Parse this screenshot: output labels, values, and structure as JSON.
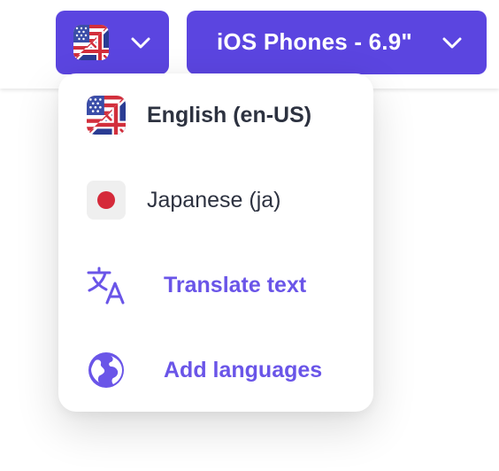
{
  "language_button": {
    "flag_icon": "us-uk-flag-icon",
    "chevron_icon": "chevron-down-icon"
  },
  "device_selector": {
    "label": "iOS Phones - 6.9\"",
    "chevron_icon": "chevron-down-icon"
  },
  "language_menu": {
    "items": [
      {
        "label": "English (en-US)",
        "icon": "us-uk-flag-icon",
        "selected": true
      },
      {
        "label": "Japanese (ja)",
        "icon": "japan-flag-icon",
        "selected": false
      }
    ],
    "actions": [
      {
        "label": "Translate text",
        "icon": "translate-icon"
      },
      {
        "label": "Add languages",
        "icon": "globe-icon"
      }
    ]
  },
  "colors": {
    "accent": "#5b45e0",
    "action_text": "#6a55e8",
    "item_text": "#2d3240"
  }
}
